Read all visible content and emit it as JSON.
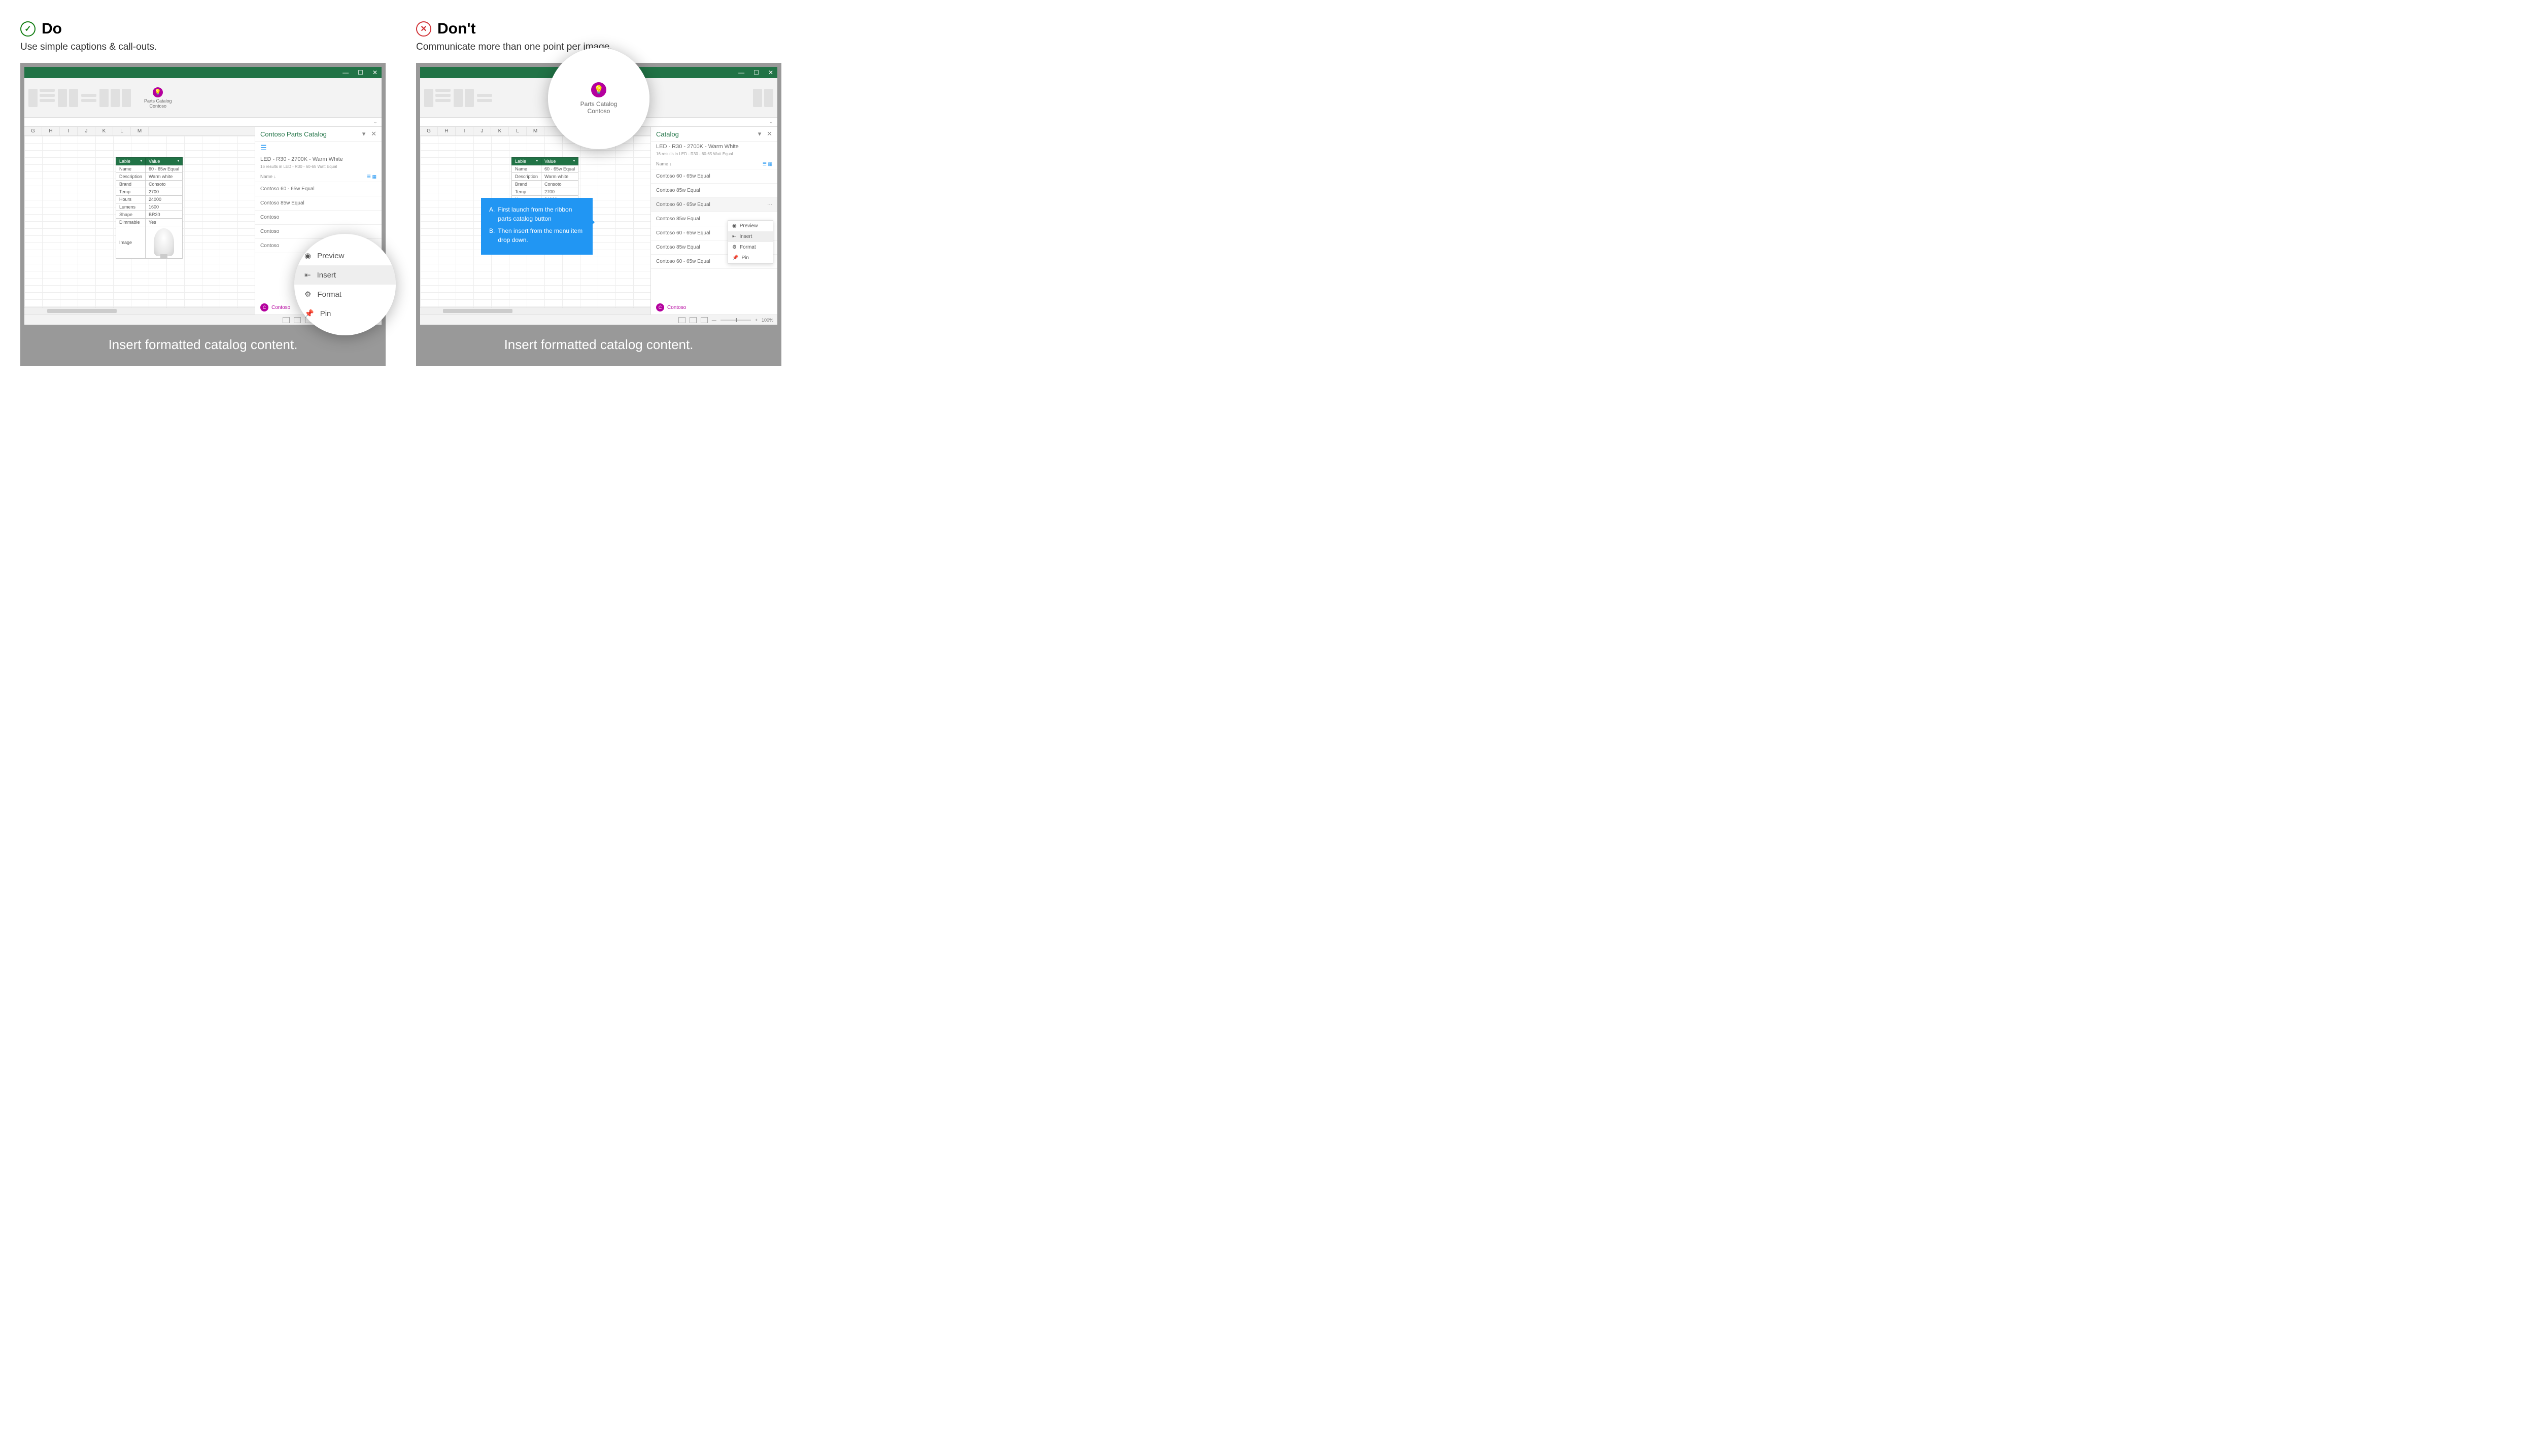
{
  "do": {
    "title": "Do",
    "subtitle": "Use simple captions & call-outs.",
    "caption": "Insert formatted catalog content."
  },
  "dont": {
    "title": "Don't",
    "subtitle": "Communicate more than one point per image.",
    "caption": "Insert formatted catalog content."
  },
  "app": {
    "addin_line1": "Parts Catalog",
    "addin_line2": "Contoso",
    "pane_title": "Contoso Parts Catalog",
    "product_title": "LED - R30 - 2700K - Warm White",
    "product_sub": "16 results in LED - R30 - 60-65 Watt Equal",
    "name_col": "Name",
    "footer": "Contoso",
    "zoom": "100%"
  },
  "cols": [
    "G",
    "H",
    "I",
    "J",
    "K",
    "L",
    "M"
  ],
  "table": {
    "h1": "Lable",
    "h2": "Value",
    "rows": [
      [
        "Name",
        "60 - 65w Equal"
      ],
      [
        "Description",
        "Warm white"
      ],
      [
        "Brand",
        "Consoto"
      ],
      [
        "Temp",
        "2700"
      ],
      [
        "Hours",
        "24000"
      ],
      [
        "Lumens",
        "1600"
      ],
      [
        "Shape",
        "BR30"
      ],
      [
        "Dimmable",
        "Yes"
      ],
      [
        "Image",
        ""
      ]
    ]
  },
  "list": [
    "Contoso 60 - 65w Equal",
    "Contoso 85w Equal",
    "Contoso 60 - 65w Equal",
    "Contoso 85w Equal",
    "Contoso 60 - 65w Equal",
    "Contoso 85w Equal",
    "Contoso 60 - 65w Equal"
  ],
  "menu": {
    "preview": "Preview",
    "insert": "Insert",
    "format": "Format",
    "pin": "Pin"
  },
  "callout": {
    "a": "First launch from the ribbon parts catalog button",
    "b": "Then insert from the menu item drop down."
  }
}
